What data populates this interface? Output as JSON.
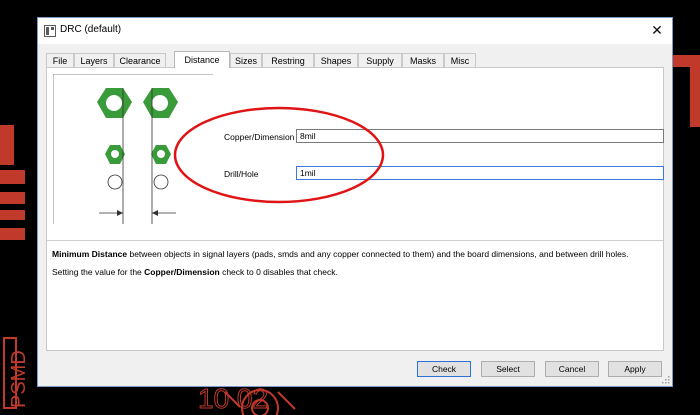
{
  "window": {
    "title": "DRC (default)",
    "close_glyph": "✕"
  },
  "tabs": [
    {
      "label": "File"
    },
    {
      "label": "Layers"
    },
    {
      "label": "Clearance"
    },
    {
      "label": "Distance",
      "active": true
    },
    {
      "label": "Sizes"
    },
    {
      "label": "Restring"
    },
    {
      "label": "Shapes"
    },
    {
      "label": "Supply"
    },
    {
      "label": "Masks"
    },
    {
      "label": "Misc"
    }
  ],
  "fields": {
    "copper_dimension": {
      "label": "Copper/Dimension",
      "value": "8mil"
    },
    "drill_hole": {
      "label": "Drill/Hole",
      "value": "1mil"
    }
  },
  "description": {
    "line1_bold": "Minimum Distance",
    "line1_rest": " between objects in signal layers (pads, smds and any copper connected to them) and the board dimensions, and between drill holes.",
    "line2_pre": "Setting the value for the ",
    "line2_bold": "Copper/Dimension",
    "line2_post": " check to 0 disables that check."
  },
  "buttons": {
    "check": "Check",
    "select": "Select",
    "cancel": "Cancel",
    "apply": "Apply"
  },
  "background_text": {
    "silk_label": "PSMD",
    "silk_digits": "10 02"
  },
  "colors": {
    "pcb_red": "#c0392b",
    "pad_green": "#3a9b3a",
    "annotation_red": "#e01414",
    "focus_blue": "#3a7ad6"
  },
  "icons": [
    "app-icon",
    "close-icon",
    "resize-grip-icon"
  ]
}
